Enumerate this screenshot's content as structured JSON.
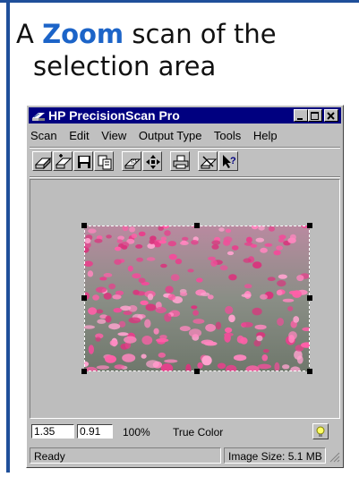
{
  "caption": {
    "prefix": "A ",
    "highlight": "Zoom",
    "suffix": " scan of the",
    "line2": "selection area"
  },
  "window": {
    "title": "HP PrecisionScan Pro",
    "menu": [
      "Scan",
      "Edit",
      "View",
      "Output Type",
      "Tools",
      "Help"
    ],
    "toolbar": [
      "scan-icon",
      "new-scan-icon",
      "save-icon",
      "copy-icon",
      "zoom-scan-icon",
      "move-icon",
      "print-icon",
      "settings-icon",
      "help-pointer-icon"
    ],
    "status_fields": {
      "width": "1.35",
      "height": "0.91",
      "zoom": "100%",
      "color_mode": "True Color"
    },
    "status": {
      "text": "Ready",
      "image_size": "Image Size: 5.1 MB"
    },
    "image": {
      "description_icon": "tulip-field-photo"
    }
  }
}
